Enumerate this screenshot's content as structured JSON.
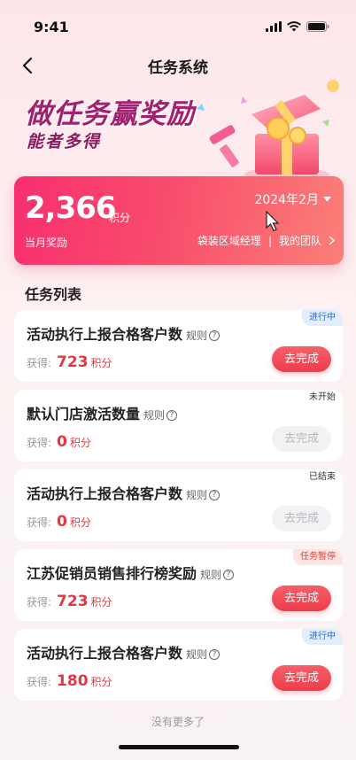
{
  "status_bar": {
    "time": "9:41"
  },
  "nav": {
    "title": "任务系统"
  },
  "banner": {
    "title": "做任务赢奖励",
    "subtitle": "能者多得"
  },
  "reward": {
    "value": "2,366",
    "unit": "积分",
    "label": "当月奖励",
    "month": "2024年2月",
    "role": "袋装区域经理",
    "separator": "|",
    "team": "我的团队"
  },
  "section": {
    "title": "任务列表"
  },
  "tasks": [
    {
      "name": "活动执行上报合格客户数",
      "rule": "规则",
      "earn_label": "获得:",
      "earn_value": "723",
      "earn_unit": "积分",
      "status": "进行中",
      "action": "去完成"
    },
    {
      "name": "默认门店激活数量",
      "rule": "规则",
      "earn_label": "获得:",
      "earn_value": "0",
      "earn_unit": "积分",
      "status": "未开始",
      "action": "去完成"
    },
    {
      "name": "活动执行上报合格客户数",
      "rule": "规则",
      "earn_label": "获得:",
      "earn_value": "0",
      "earn_unit": "积分",
      "status": "已结束",
      "action": "去完成"
    },
    {
      "name": "江苏促销员销售排行榜奖励",
      "rule": "规则",
      "earn_label": "获得:",
      "earn_value": "723",
      "earn_unit": "积分",
      "status": "任务暂停",
      "action": "去完成"
    },
    {
      "name": "活动执行上报合格客户数",
      "rule": "规则",
      "earn_label": "获得:",
      "earn_value": "180",
      "earn_unit": "积分",
      "status": "进行中",
      "action": "去完成"
    }
  ],
  "footer": {
    "no_more": "没有更多了"
  },
  "colors": {
    "accent": "#f72f6e",
    "earn": "#e8353f",
    "running_tag": "#2d6ad6",
    "paused_tag": "#e6403b"
  }
}
